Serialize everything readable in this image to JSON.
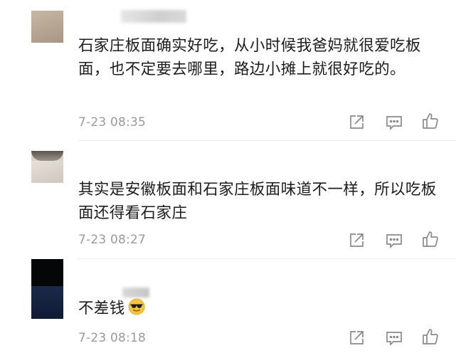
{
  "comments": [
    {
      "text": "石家庄板面确实好吃，从小时候我爸妈就很爱吃板面，也不定要去哪里，路边小摊上就很好吃的。",
      "time": "7-23 08:35"
    },
    {
      "text": "其实是安徽板面和石家庄板面味道不一样，所以吃板面还得看石家庄",
      "time": "7-23 08:27"
    },
    {
      "text": "不差钱",
      "time": "7-23 08:18",
      "emoji": "sunglasses-face-emoji"
    }
  ],
  "actions": {
    "share_icon": "share-icon",
    "reply_icon": "comment-icon",
    "like_icon": "thumbs-up-icon"
  },
  "colors": {
    "text": "#1c1c1c",
    "meta": "#9a9a9a",
    "icon": "#8a8a8a"
  }
}
